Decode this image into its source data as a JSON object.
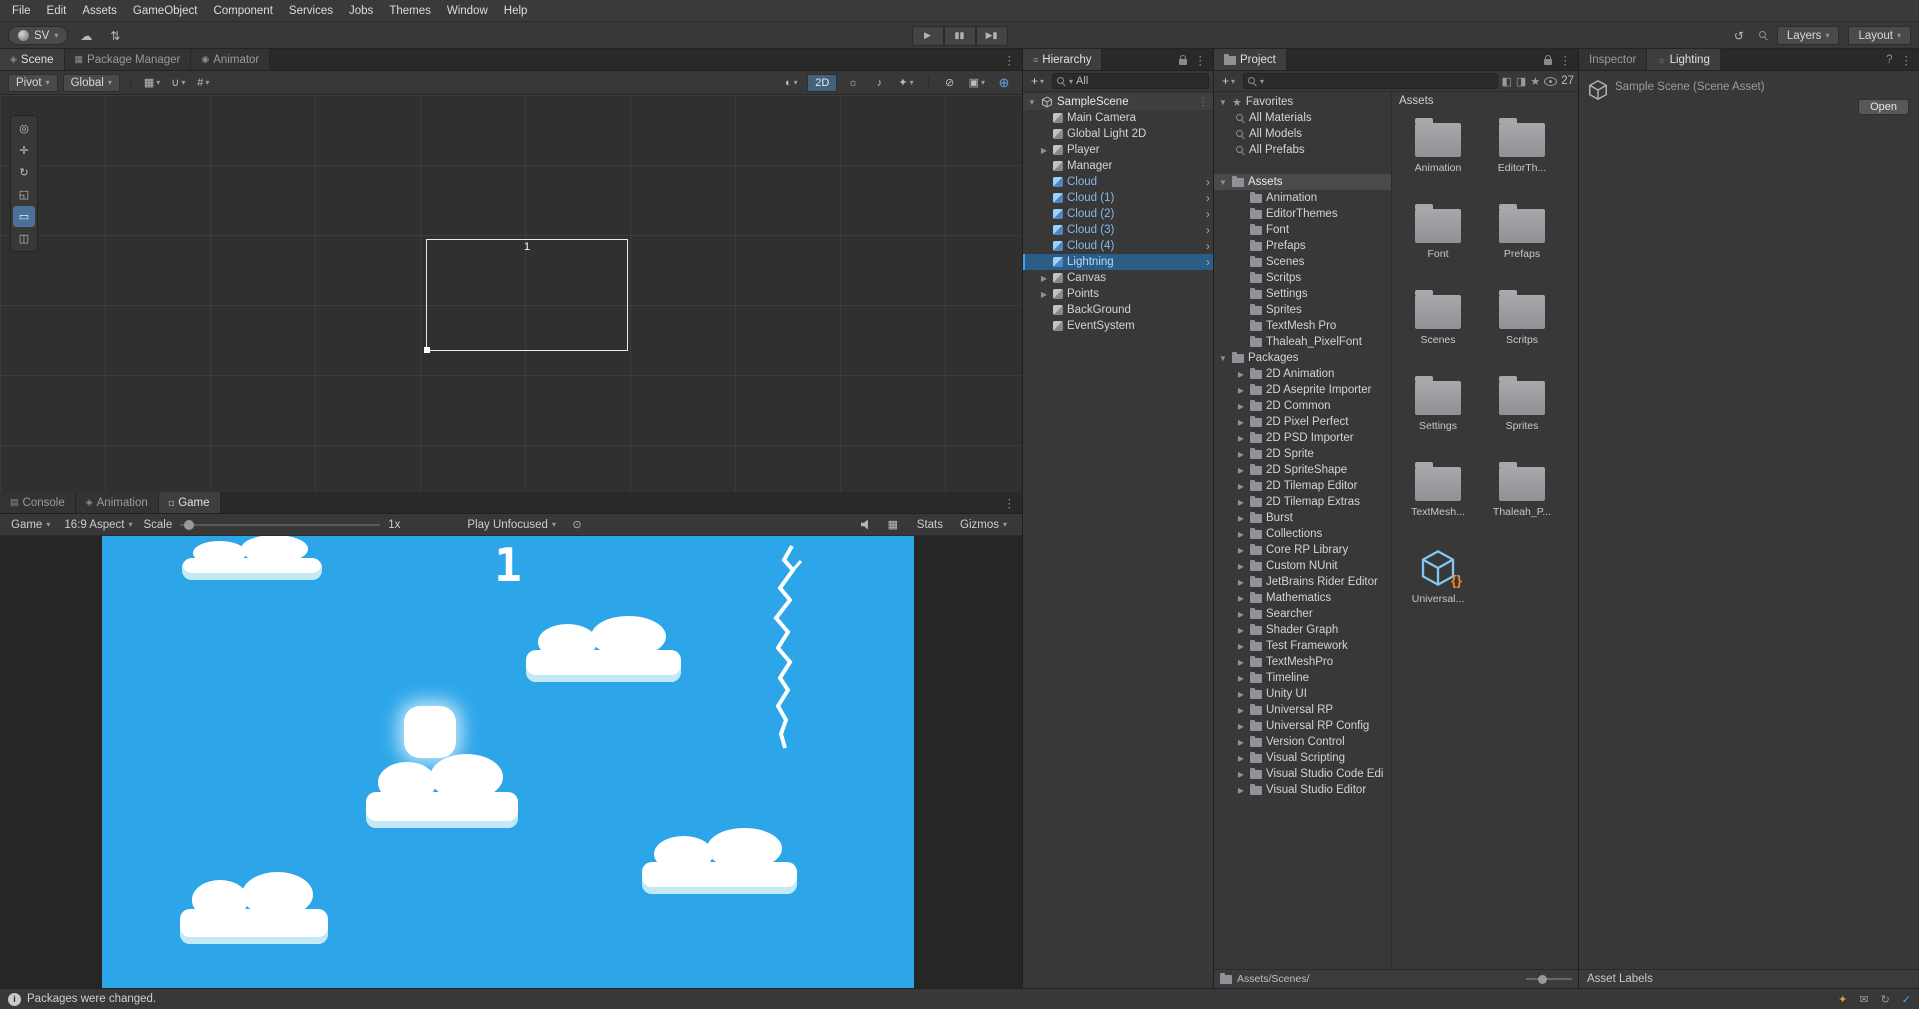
{
  "colors": {
    "selection_blue": "#2C5D87",
    "prefab_text": "#85B9E8",
    "sky_blue": "#2CA6E9",
    "accent_blue": "#44A0F7",
    "panel_bg": "#383838"
  },
  "icons": {
    "dropdown": "▾",
    "expanded": "▼",
    "collapsed": "▶",
    "chevron_right": "›",
    "kebab": "⋮",
    "menu": "≡",
    "plus": "+",
    "play": "▶",
    "pause": "▮▮",
    "step": "▶▮",
    "cloud": "☁",
    "sync": "⇅",
    "history": "↺",
    "shading": "◐",
    "light": "☼",
    "audio": "♪",
    "effects": "✦",
    "hidden": "⊘",
    "camera": "▣",
    "gizmo": "⊕",
    "grid": "▦",
    "magnet": "∪",
    "snap": "#",
    "view_tool": "◎",
    "move_tool": "✛",
    "rotate_tool": "↻",
    "scale_tool": "◱",
    "rect_tool": "▭",
    "transform_tool": "◫",
    "star": "★",
    "info": "i",
    "help": "?",
    "braces": "{}",
    "debug": "⊙",
    "spark": "✦",
    "mail": "✉",
    "refresh": "↻",
    "check": "✓",
    "type_filter": "◧",
    "label_filter": "◨"
  },
  "menu": {
    "items": [
      "File",
      "Edit",
      "Assets",
      "GameObject",
      "Component",
      "Services",
      "Jobs",
      "Themes",
      "Window",
      "Help"
    ]
  },
  "toolbar": {
    "account_label": "SV",
    "layers": "Layers",
    "layout": "Layout"
  },
  "scene_tabs": [
    {
      "label": "Scene",
      "icon": "◈",
      "active": true
    },
    {
      "label": "Package Manager",
      "icon": "▦"
    },
    {
      "label": "Animator",
      "icon": "◉"
    }
  ],
  "scene_toolbar": {
    "pivot": "Pivot",
    "global": "Global",
    "mode2d": "2D"
  },
  "scene_view": {
    "selection_label": "1"
  },
  "bottom_tabs": [
    {
      "label": "Console",
      "icon": "▤"
    },
    {
      "label": "Animation",
      "icon": "◈"
    },
    {
      "label": "Game",
      "icon": "◘",
      "active": true
    }
  ],
  "game_toolbar": {
    "display": "Game",
    "aspect": "16:9 Aspect",
    "scale_label": "Scale",
    "scale_value": "1x",
    "focus_mode": "Play Unfocused",
    "stats": "Stats",
    "gizmos": "Gizmos"
  },
  "game_view": {
    "score": "1"
  },
  "hierarchy": {
    "tab": "Hierarchy",
    "search_filter": "All",
    "scene_name": "SampleScene",
    "items": [
      {
        "label": "Main Camera"
      },
      {
        "label": "Global Light 2D"
      },
      {
        "label": "Player",
        "expand": true
      },
      {
        "label": "Manager"
      },
      {
        "label": "Cloud",
        "prefab": true
      },
      {
        "label": "Cloud (1)",
        "prefab": true
      },
      {
        "label": "Cloud (2)",
        "prefab": true
      },
      {
        "label": "Cloud (3)",
        "prefab": true
      },
      {
        "label": "Cloud (4)",
        "prefab": true
      },
      {
        "label": "Lightning",
        "prefab": true,
        "selected": true
      },
      {
        "label": "Canvas",
        "expand": true
      },
      {
        "label": "Points",
        "expand": true
      },
      {
        "label": "BackGround"
      },
      {
        "label": "EventSystem"
      }
    ]
  },
  "project": {
    "tab": "Project",
    "hidden_count": "27",
    "favorites_label": "Favorites",
    "favorites": [
      "All Materials",
      "All Models",
      "All Prefabs"
    ],
    "assets_label": "Assets",
    "asset_folders": [
      "Animation",
      "EditorThemes",
      "Font",
      "Prefaps",
      "Scenes",
      "Scritps",
      "Settings",
      "Sprites",
      "TextMesh Pro",
      "Thaleah_PixelFont"
    ],
    "packages_label": "Packages",
    "packages": [
      "2D Animation",
      "2D Aseprite Importer",
      "2D Common",
      "2D Pixel Perfect",
      "2D PSD Importer",
      "2D Sprite",
      "2D SpriteShape",
      "2D Tilemap Editor",
      "2D Tilemap Extras",
      "Burst",
      "Collections",
      "Core RP Library",
      "Custom NUnit",
      "JetBrains Rider Editor",
      "Mathematics",
      "Searcher",
      "Shader Graph",
      "Test Framework",
      "TextMeshPro",
      "Timeline",
      "Unity UI",
      "Universal RP",
      "Universal RP Config",
      "Version Control",
      "Visual Scripting",
      "Visual Studio Code Edi",
      "Visual Studio Editor"
    ],
    "grid_header": "Assets",
    "grid_items": [
      {
        "label": "Animation"
      },
      {
        "label": "EditorTh..."
      },
      {
        "label": "Font"
      },
      {
        "label": "Prefaps"
      },
      {
        "label": "Scenes"
      },
      {
        "label": "Scritps"
      },
      {
        "label": "Settings"
      },
      {
        "label": "Sprites"
      },
      {
        "label": "TextMesh..."
      },
      {
        "label": "Thaleah_P..."
      },
      {
        "label": "Universal...",
        "package": true
      }
    ],
    "breadcrumb": "Assets/Scenes/"
  },
  "inspector": {
    "tabs": [
      {
        "label": "Inspector",
        "icon": ""
      },
      {
        "label": "Lighting",
        "icon": "☼",
        "active": true
      }
    ],
    "asset_title": "Sample Scene (Scene Asset)",
    "open_button": "Open",
    "asset_labels_header": "Asset Labels"
  },
  "status_bar": {
    "message": "Packages were changed."
  }
}
